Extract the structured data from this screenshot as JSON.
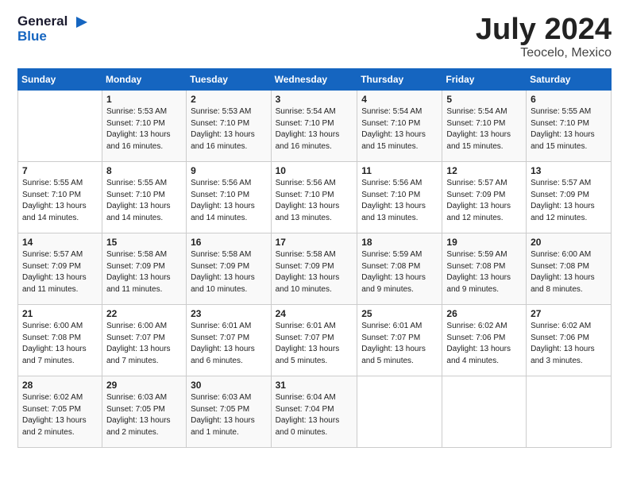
{
  "header": {
    "logo_line1": "General",
    "logo_line2": "Blue",
    "month": "July 2024",
    "location": "Teocelo, Mexico"
  },
  "weekdays": [
    "Sunday",
    "Monday",
    "Tuesday",
    "Wednesday",
    "Thursday",
    "Friday",
    "Saturday"
  ],
  "weeks": [
    [
      {
        "day": "",
        "info": ""
      },
      {
        "day": "1",
        "info": "Sunrise: 5:53 AM\nSunset: 7:10 PM\nDaylight: 13 hours\nand 16 minutes."
      },
      {
        "day": "2",
        "info": "Sunrise: 5:53 AM\nSunset: 7:10 PM\nDaylight: 13 hours\nand 16 minutes."
      },
      {
        "day": "3",
        "info": "Sunrise: 5:54 AM\nSunset: 7:10 PM\nDaylight: 13 hours\nand 16 minutes."
      },
      {
        "day": "4",
        "info": "Sunrise: 5:54 AM\nSunset: 7:10 PM\nDaylight: 13 hours\nand 15 minutes."
      },
      {
        "day": "5",
        "info": "Sunrise: 5:54 AM\nSunset: 7:10 PM\nDaylight: 13 hours\nand 15 minutes."
      },
      {
        "day": "6",
        "info": "Sunrise: 5:55 AM\nSunset: 7:10 PM\nDaylight: 13 hours\nand 15 minutes."
      }
    ],
    [
      {
        "day": "7",
        "info": "Sunrise: 5:55 AM\nSunset: 7:10 PM\nDaylight: 13 hours\nand 14 minutes."
      },
      {
        "day": "8",
        "info": "Sunrise: 5:55 AM\nSunset: 7:10 PM\nDaylight: 13 hours\nand 14 minutes."
      },
      {
        "day": "9",
        "info": "Sunrise: 5:56 AM\nSunset: 7:10 PM\nDaylight: 13 hours\nand 14 minutes."
      },
      {
        "day": "10",
        "info": "Sunrise: 5:56 AM\nSunset: 7:10 PM\nDaylight: 13 hours\nand 13 minutes."
      },
      {
        "day": "11",
        "info": "Sunrise: 5:56 AM\nSunset: 7:10 PM\nDaylight: 13 hours\nand 13 minutes."
      },
      {
        "day": "12",
        "info": "Sunrise: 5:57 AM\nSunset: 7:09 PM\nDaylight: 13 hours\nand 12 minutes."
      },
      {
        "day": "13",
        "info": "Sunrise: 5:57 AM\nSunset: 7:09 PM\nDaylight: 13 hours\nand 12 minutes."
      }
    ],
    [
      {
        "day": "14",
        "info": "Sunrise: 5:57 AM\nSunset: 7:09 PM\nDaylight: 13 hours\nand 11 minutes."
      },
      {
        "day": "15",
        "info": "Sunrise: 5:58 AM\nSunset: 7:09 PM\nDaylight: 13 hours\nand 11 minutes."
      },
      {
        "day": "16",
        "info": "Sunrise: 5:58 AM\nSunset: 7:09 PM\nDaylight: 13 hours\nand 10 minutes."
      },
      {
        "day": "17",
        "info": "Sunrise: 5:58 AM\nSunset: 7:09 PM\nDaylight: 13 hours\nand 10 minutes."
      },
      {
        "day": "18",
        "info": "Sunrise: 5:59 AM\nSunset: 7:08 PM\nDaylight: 13 hours\nand 9 minutes."
      },
      {
        "day": "19",
        "info": "Sunrise: 5:59 AM\nSunset: 7:08 PM\nDaylight: 13 hours\nand 9 minutes."
      },
      {
        "day": "20",
        "info": "Sunrise: 6:00 AM\nSunset: 7:08 PM\nDaylight: 13 hours\nand 8 minutes."
      }
    ],
    [
      {
        "day": "21",
        "info": "Sunrise: 6:00 AM\nSunset: 7:08 PM\nDaylight: 13 hours\nand 7 minutes."
      },
      {
        "day": "22",
        "info": "Sunrise: 6:00 AM\nSunset: 7:07 PM\nDaylight: 13 hours\nand 7 minutes."
      },
      {
        "day": "23",
        "info": "Sunrise: 6:01 AM\nSunset: 7:07 PM\nDaylight: 13 hours\nand 6 minutes."
      },
      {
        "day": "24",
        "info": "Sunrise: 6:01 AM\nSunset: 7:07 PM\nDaylight: 13 hours\nand 5 minutes."
      },
      {
        "day": "25",
        "info": "Sunrise: 6:01 AM\nSunset: 7:07 PM\nDaylight: 13 hours\nand 5 minutes."
      },
      {
        "day": "26",
        "info": "Sunrise: 6:02 AM\nSunset: 7:06 PM\nDaylight: 13 hours\nand 4 minutes."
      },
      {
        "day": "27",
        "info": "Sunrise: 6:02 AM\nSunset: 7:06 PM\nDaylight: 13 hours\nand 3 minutes."
      }
    ],
    [
      {
        "day": "28",
        "info": "Sunrise: 6:02 AM\nSunset: 7:05 PM\nDaylight: 13 hours\nand 2 minutes."
      },
      {
        "day": "29",
        "info": "Sunrise: 6:03 AM\nSunset: 7:05 PM\nDaylight: 13 hours\nand 2 minutes."
      },
      {
        "day": "30",
        "info": "Sunrise: 6:03 AM\nSunset: 7:05 PM\nDaylight: 13 hours\nand 1 minute."
      },
      {
        "day": "31",
        "info": "Sunrise: 6:04 AM\nSunset: 7:04 PM\nDaylight: 13 hours\nand 0 minutes."
      },
      {
        "day": "",
        "info": ""
      },
      {
        "day": "",
        "info": ""
      },
      {
        "day": "",
        "info": ""
      }
    ]
  ]
}
